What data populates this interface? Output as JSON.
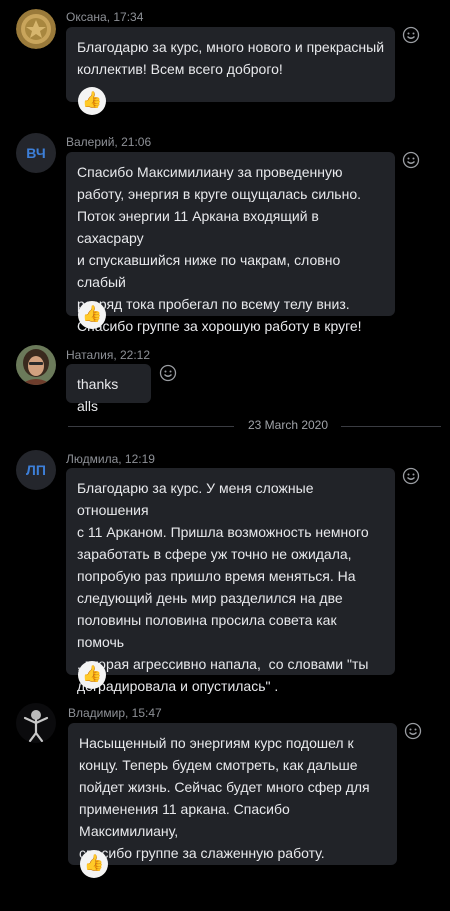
{
  "messages": [
    {
      "author": "Оксана",
      "time": "17:34",
      "meta": "Оксана, 17:34",
      "avatar_type": "photo",
      "text": "Благодарю за курс, много нового и прекрасный\nколлектив! Всем всего доброго!",
      "reaction": "👍"
    },
    {
      "author": "Валерий",
      "time": "21:06",
      "meta": "Валерий, 21:06",
      "avatar_type": "initials",
      "initials": "ВЧ",
      "text": "Спасибо Максимилиану за проведенную\nработу, энергия в круге ощущалась сильно.\nПоток энергии 11 Аркана входящий в сахасрару\nи спускавшийся ниже по чакрам, словно слабый\nразряд тока пробегал по всему телу вниз.\nСпасибо группе за хорошую работу в круге!",
      "reaction": "👍"
    },
    {
      "author": "Наталия",
      "time": "22:12",
      "meta": "Наталия, 22:12",
      "avatar_type": "photo",
      "text": "thanks alls"
    },
    {
      "author": "Людмила",
      "time": "12:19",
      "meta": "Людмила, 12:19",
      "avatar_type": "initials",
      "initials": "ЛП",
      "text": "Благодарю за курс. У меня сложные отношения\nс 11 Арканом. Пришла возможность немного\nзаработать в сфере уж точно не ожидала,\nпопробую раз пришло время меняться. На\nследующий день мир разделился на две\nполовины половина просила совета как помочь\n, вторая агрессивно напала,  со словами \"ты\nдеградировала и опустилась\" .",
      "reaction": "👍"
    },
    {
      "author": "Владимир",
      "time": "15:47",
      "meta": "Владимир, 15:47",
      "avatar_type": "photo",
      "text": "Насыщенный по энергиям курс подошел к\nконцу. Теперь будем смотреть, как дальше\nпойдет жизнь. Сейчас будет много сфер для\nприменения 11 аркана. Спасибо Максимилиану,\nспасибо группе за слаженную работу.",
      "reaction": "👍"
    }
  ],
  "date_separator": "23 March 2020",
  "icons": {
    "react": "smiley-icon",
    "reaction": "thumbs-up-icon"
  },
  "colors": {
    "background": "#000000",
    "bubble": "#212328",
    "meta_text": "#8e9197",
    "initials_text": "#3d7fd8",
    "reaction_bg": "#f4f4f4"
  }
}
